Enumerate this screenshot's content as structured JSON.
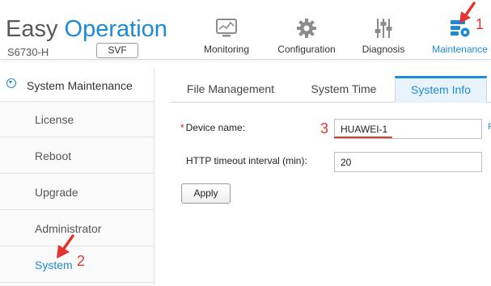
{
  "header": {
    "logo_word1": "Easy",
    "logo_word2": "Operation",
    "model": "S6730-H",
    "svf_button": "SVF",
    "nav": [
      {
        "label": "Monitoring",
        "icon": "monitor-icon"
      },
      {
        "label": "Configuration",
        "icon": "gear-icon"
      },
      {
        "label": "Diagnosis",
        "icon": "sliders-icon"
      },
      {
        "label": "Maintenance",
        "icon": "maintenance-icon",
        "active": true
      }
    ]
  },
  "sidebar": {
    "section": "System Maintenance",
    "items": [
      {
        "label": "License"
      },
      {
        "label": "Reboot"
      },
      {
        "label": "Upgrade"
      },
      {
        "label": "Administrator"
      },
      {
        "label": "System",
        "active": true
      }
    ]
  },
  "tabs": [
    {
      "label": "File Management"
    },
    {
      "label": "System Time"
    },
    {
      "label": "System Info",
      "active": true
    }
  ],
  "form": {
    "required_mark": "*",
    "device_name_label": "Device name:",
    "device_name_value": "HUAWEI-1",
    "http_timeout_label": "HTTP timeout interval (min):",
    "http_timeout_value": "20",
    "apply_label": "Apply",
    "edge_fragment": "R"
  },
  "annotations": {
    "step1": "1",
    "step2": "2",
    "step3": "3",
    "color": "#e3342f"
  },
  "colors": {
    "accent": "#1c8ad6",
    "annotation": "#e3342f"
  }
}
